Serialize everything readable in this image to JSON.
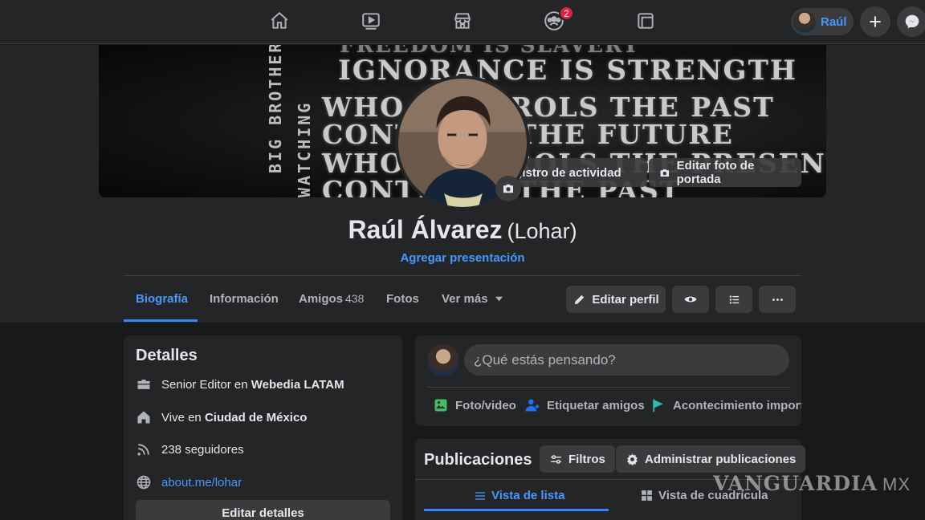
{
  "topnav": {
    "notification_count": "2",
    "user_name": "Raúl"
  },
  "cover": {
    "lines": [
      "FREEDOM IS SLAVERY",
      "IGNORANCE IS STRENGTH",
      "WHO CONTROLS THE PAST",
      "CONTROLS THE FUTURE",
      "WHO CONTROLS THE PRESENT",
      "CONTROLS THE PAST"
    ],
    "vertical_1": "BIG BROTHER",
    "vertical_2": "WATCHING",
    "activity_log_label": "Registro de actividad",
    "edit_cover_label": "Editar foto de portada"
  },
  "profile": {
    "name": "Raúl Álvarez",
    "alternate_name": "(Lohar)",
    "add_bio_label": "Agregar presentación"
  },
  "tabs": [
    {
      "label": "Biografía"
    },
    {
      "label": "Información"
    },
    {
      "label": "Amigos",
      "count": "438"
    },
    {
      "label": "Fotos"
    },
    {
      "label": "Ver más"
    }
  ],
  "header_actions": {
    "edit_profile_label": "Editar perfil"
  },
  "details": {
    "title": "Detalles",
    "work_prefix": "Senior Editor en",
    "work_company": "Webedia LATAM",
    "lives_prefix": "Vive en",
    "lives_city": "Ciudad de México",
    "followers": "238 seguidores",
    "website": "about.me/lohar",
    "edit_label": "Editar detalles"
  },
  "composer": {
    "placeholder": "¿Qué estás pensando?",
    "photo_video": "Foto/video",
    "tag_friends": "Etiquetar amigos",
    "life_event": "Acontecimiento importante"
  },
  "posts": {
    "title": "Publicaciones",
    "filters_label": "Filtros",
    "manage_label": "Administrar publicaciones",
    "list_view": "Vista de lista",
    "grid_view": "Vista de cuadrícula"
  },
  "watermark": {
    "brand": "VANGUARDIA",
    "country": "MX"
  },
  "colors": {
    "accent": "#2d88ff",
    "link": "#4599ff",
    "surface": "#242526",
    "background": "#18191a"
  }
}
